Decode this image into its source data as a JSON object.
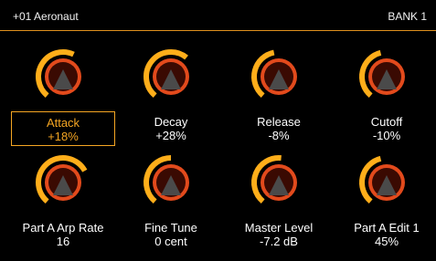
{
  "header": {
    "preset_name": "+01 Aeronaut",
    "bank": "BANK 1"
  },
  "colors": {
    "accent": "#f5a623",
    "knob_outer": "#ffae1a",
    "knob_inner": "#e24a1c",
    "knob_core": "#3a0a02",
    "pointer": "#4a4a4a"
  },
  "params": [
    {
      "name": "Attack",
      "value": "+18%",
      "level": 0.59,
      "selected": true
    },
    {
      "name": "Decay",
      "value": "+28%",
      "level": 0.64,
      "selected": false
    },
    {
      "name": "Release",
      "value": "-8%",
      "level": 0.46,
      "selected": false
    },
    {
      "name": "Cutoff",
      "value": "-10%",
      "level": 0.45,
      "selected": false
    },
    {
      "name": "Part A Arp Rate",
      "value": "16",
      "level": 0.72,
      "selected": false
    },
    {
      "name": "Fine Tune",
      "value": "0 cent",
      "level": 0.5,
      "selected": false
    },
    {
      "name": "Master Level",
      "value": "-7.2 dB",
      "level": 0.52,
      "selected": false
    },
    {
      "name": "Part A Edit 1",
      "value": "45%",
      "level": 0.45,
      "selected": false
    }
  ]
}
